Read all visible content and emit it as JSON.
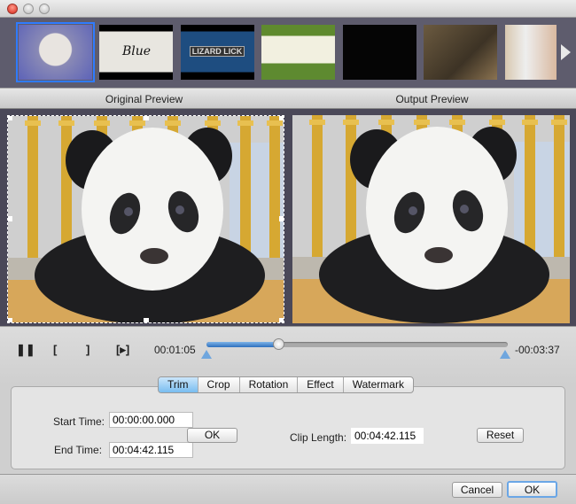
{
  "window": {
    "buttons": [
      "close",
      "minimize",
      "zoom"
    ]
  },
  "thumbnails": [
    {
      "name": "kitten",
      "selected": true
    },
    {
      "name": "blue-title",
      "logo_text": "Blue"
    },
    {
      "name": "lizard-lick",
      "logo_text": "LIZARD LICK"
    },
    {
      "name": "laundry-scene"
    },
    {
      "name": "black-title"
    },
    {
      "name": "western-scene"
    },
    {
      "name": "drawing-hand"
    }
  ],
  "preview": {
    "original_label": "Original Preview",
    "output_label": "Output Preview"
  },
  "player": {
    "current_time": "00:01:05",
    "remaining_time": "-00:03:37",
    "progress_percent": 24,
    "icons": [
      "pause-icon",
      "mark-in-icon",
      "mark-out-icon",
      "play-segment-icon"
    ]
  },
  "tabs": [
    {
      "label": "Trim",
      "active": true
    },
    {
      "label": "Crop"
    },
    {
      "label": "Rotation"
    },
    {
      "label": "Effect"
    },
    {
      "label": "Watermark"
    }
  ],
  "trim": {
    "start_label": "Start Time:",
    "start_value": "00:00:00.000",
    "end_label": "End Time:",
    "end_value": "00:04:42.115",
    "ok_label": "OK",
    "clip_length_label": "Clip Length:",
    "clip_length_value": "00:04:42.115",
    "reset_label": "Reset"
  },
  "footer": {
    "cancel_label": "Cancel",
    "ok_label": "OK"
  },
  "colors": {
    "accent": "#2f7bff",
    "tab_active": "#79bdf0"
  }
}
